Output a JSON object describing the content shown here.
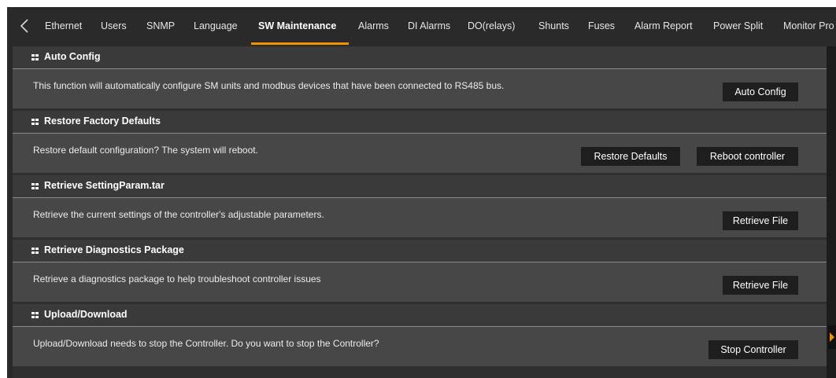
{
  "tabs": [
    {
      "label": "Ethernet"
    },
    {
      "label": "Users"
    },
    {
      "label": "SNMP"
    },
    {
      "label": "Language"
    },
    {
      "label": "SW Maintenance",
      "active": true
    },
    {
      "label": "Alarms"
    },
    {
      "label": "DI Alarms"
    },
    {
      "label": "DO(relays)"
    },
    {
      "label": "Shunts"
    },
    {
      "label": "Fuses"
    },
    {
      "label": "Alarm Report"
    },
    {
      "label": "Power Split"
    },
    {
      "label": "Monitor Pro"
    }
  ],
  "sections": [
    {
      "title": "Auto Config",
      "description": "This function will automatically configure SM units and modbus devices that have been connected to RS485 bus.",
      "buttons": [
        "Auto Config"
      ]
    },
    {
      "title": "Restore Factory Defaults",
      "description": "Restore default configuration? The system will reboot.",
      "buttons": [
        "Restore Defaults",
        "Reboot controller"
      ]
    },
    {
      "title": "Retrieve SettingParam.tar",
      "description": "Retrieve the current settings of the controller's adjustable parameters.",
      "buttons": [
        "Retrieve File"
      ]
    },
    {
      "title": "Retrieve Diagnostics Package",
      "description": "Retrieve a diagnostics package to help troubleshoot controller issues",
      "buttons": [
        "Retrieve File"
      ]
    },
    {
      "title": "Upload/Download",
      "description": "Upload/Download needs to stop the Controller. Do you want to stop the Controller?",
      "buttons": [
        "Stop Controller"
      ]
    }
  ],
  "colors": {
    "accent": "#f39200",
    "background": "#2a2a2a",
    "panel": "#474747"
  }
}
